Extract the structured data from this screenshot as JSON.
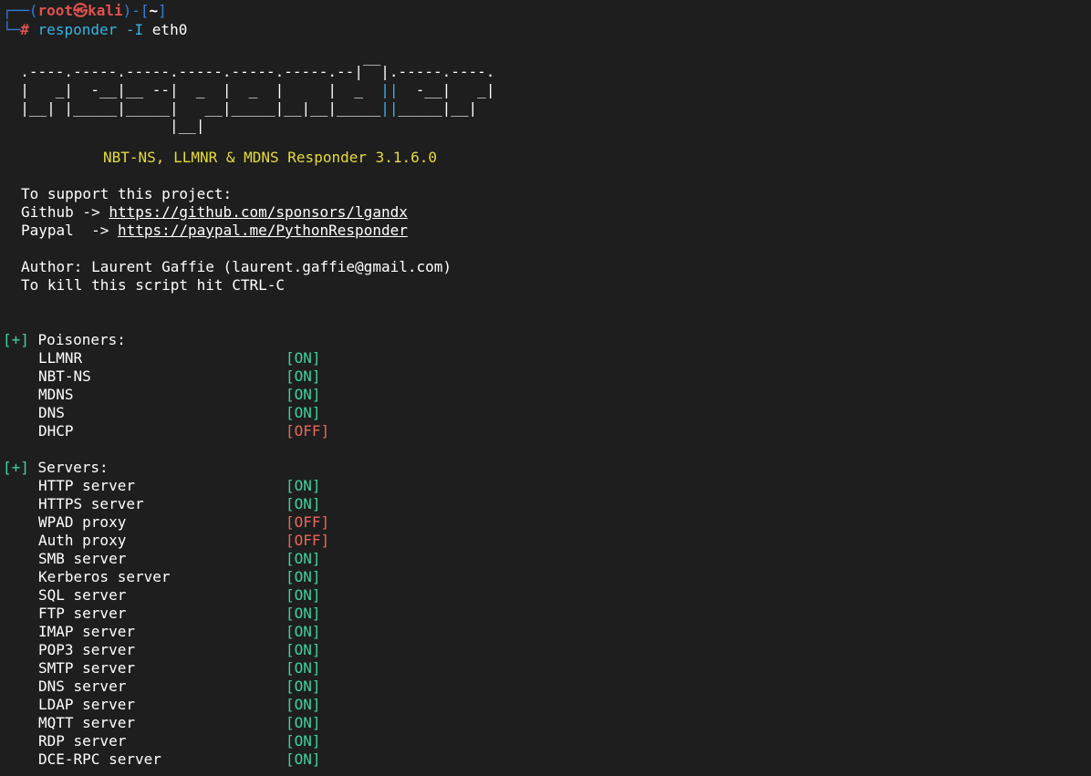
{
  "prompt": {
    "corner_top": "┌──(",
    "user": "root㉿",
    "host": "kali",
    "sep1": ")-[",
    "cwd": "~",
    "sep2": "]",
    "corner_bottom": "└─",
    "hash": "#",
    "command": "responder",
    "flag": "-I",
    "arg": "eth0"
  },
  "banner": {
    "art": [
      "                                         __",
      "  .----.-----.-----.-----.-----.-----.--|  |.-----.----.",
      "  |   _|  -__|__ --|  _  |  _  |     |  _  ||  -__|   _|",
      "  |__| |_____|_____|   __|_____|__|__|_____||_____|__|",
      "                   |__|"
    ],
    "subtitle": "NBT-NS, LLMNR & MDNS Responder 3.1.6.0"
  },
  "support": {
    "heading": "To support this project:",
    "github_label": "Github -> ",
    "github_url": "https://github.com/sponsors/lgandx",
    "paypal_label": "Paypal  -> ",
    "paypal_url": "https://paypal.me/PythonResponder",
    "author": "Author: Laurent Gaffie (laurent.gaffie@gmail.com)",
    "kill": "To kill this script hit CTRL-C"
  },
  "marker": "[+]",
  "poisoners": {
    "title": "Poisoners:",
    "items": [
      {
        "name": "LLMNR",
        "status": "[ON]"
      },
      {
        "name": "NBT-NS",
        "status": "[ON]"
      },
      {
        "name": "MDNS",
        "status": "[ON]"
      },
      {
        "name": "DNS",
        "status": "[ON]"
      },
      {
        "name": "DHCP",
        "status": "[OFF]"
      }
    ]
  },
  "servers": {
    "title": "Servers:",
    "items": [
      {
        "name": "HTTP server",
        "status": "[ON]"
      },
      {
        "name": "HTTPS server",
        "status": "[ON]"
      },
      {
        "name": "WPAD proxy",
        "status": "[OFF]"
      },
      {
        "name": "Auth proxy",
        "status": "[OFF]"
      },
      {
        "name": "SMB server",
        "status": "[ON]"
      },
      {
        "name": "Kerberos server",
        "status": "[ON]"
      },
      {
        "name": "SQL server",
        "status": "[ON]"
      },
      {
        "name": "FTP server",
        "status": "[ON]"
      },
      {
        "name": "IMAP server",
        "status": "[ON]"
      },
      {
        "name": "POP3 server",
        "status": "[ON]"
      },
      {
        "name": "SMTP server",
        "status": "[ON]"
      },
      {
        "name": "DNS server",
        "status": "[ON]"
      },
      {
        "name": "LDAP server",
        "status": "[ON]"
      },
      {
        "name": "MQTT server",
        "status": "[ON]"
      },
      {
        "name": "RDP server",
        "status": "[ON]"
      },
      {
        "name": "DCE-RPC server",
        "status": "[ON]"
      }
    ]
  },
  "colors": {
    "background": "#1e1e1e",
    "prompt_frame": "#2f7fdc",
    "root_host": "#e0524f",
    "command": "#39b3e6",
    "banner": "#e6db3c",
    "marker_on": "#3fd29c",
    "off": "#e8675d"
  }
}
